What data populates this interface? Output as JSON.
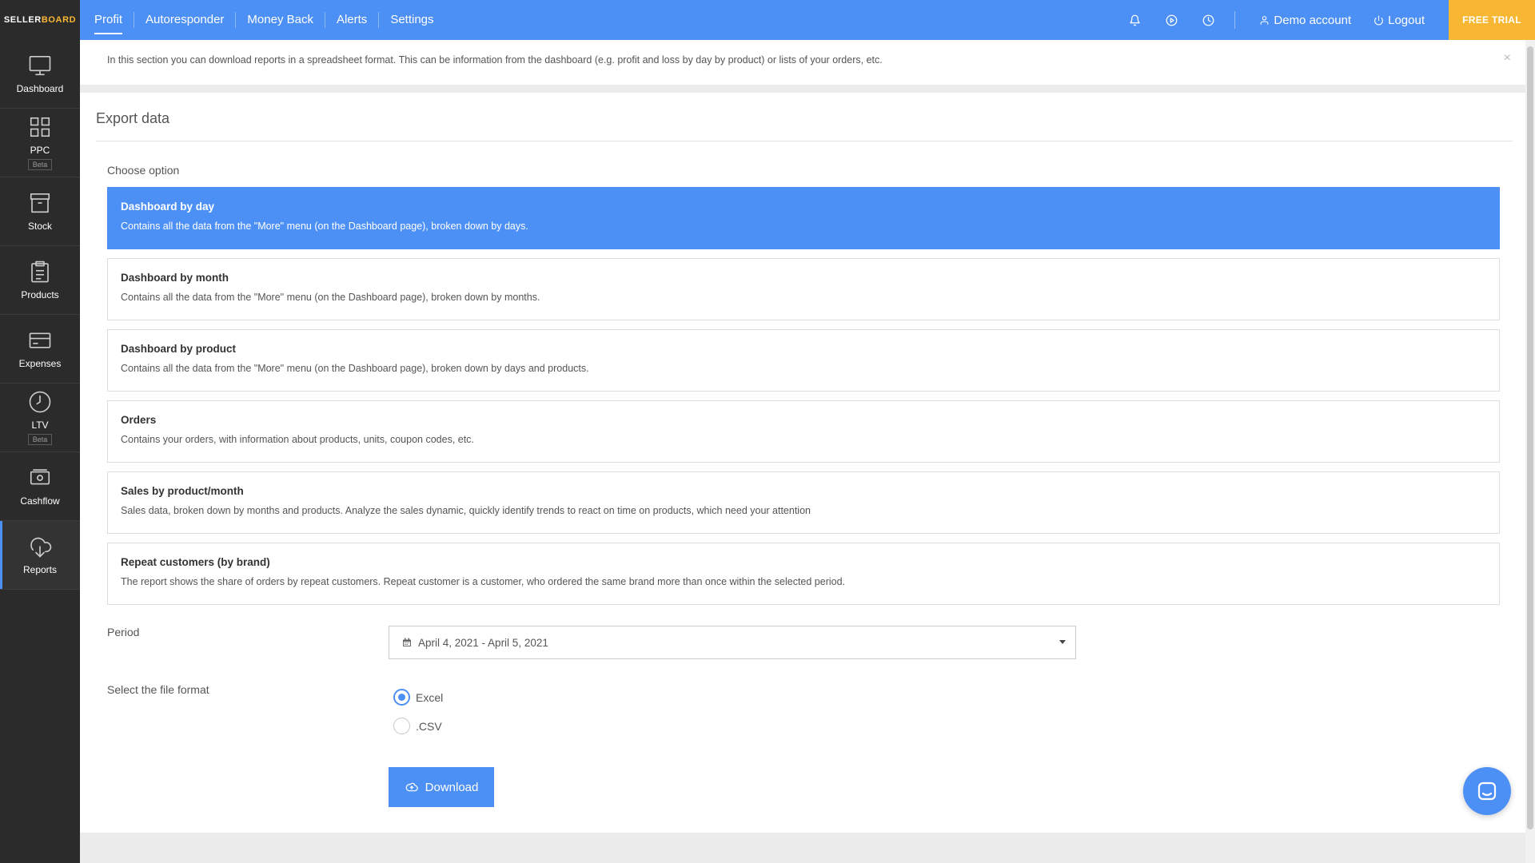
{
  "app": {
    "logo_part1": "SELLER",
    "logo_part2": "BOARD"
  },
  "topnav": {
    "items": [
      {
        "label": "Profit",
        "active": true
      },
      {
        "label": "Autoresponder"
      },
      {
        "label": "Money Back"
      },
      {
        "label": "Alerts"
      },
      {
        "label": "Settings"
      }
    ],
    "icons": [
      "bell-icon",
      "play-circle-icon",
      "clock-icon"
    ],
    "account_label": "Demo account",
    "logout_label": "Logout",
    "trial_label": "FREE TRIAL"
  },
  "sidebar": {
    "items": [
      {
        "label": "Dashboard",
        "icon": "monitor-icon"
      },
      {
        "label": "PPC",
        "icon": "grid-icon",
        "badge": "Beta"
      },
      {
        "label": "Stock",
        "icon": "box-icon"
      },
      {
        "label": "Products",
        "icon": "clipboard-icon"
      },
      {
        "label": "Expenses",
        "icon": "credit-card-icon"
      },
      {
        "label": "LTV",
        "icon": "clock-icon",
        "badge": "Beta"
      },
      {
        "label": "Cashflow",
        "icon": "cash-icon"
      },
      {
        "label": "Reports",
        "icon": "cloud-download-icon",
        "active": true
      }
    ]
  },
  "banner": {
    "text": "In this section you can download reports in a spreadsheet format. This can be information from the dashboard (e.g. profit and loss by day by product) or lists of your orders, etc.",
    "close_glyph": "×"
  },
  "export": {
    "title": "Export data",
    "choose_label": "Choose option",
    "options": [
      {
        "title": "Dashboard by day",
        "desc": "Contains all the data from the \"More\" menu (on the Dashboard page), broken down by days.",
        "selected": true
      },
      {
        "title": "Dashboard by month",
        "desc": "Contains all the data from the \"More\" menu (on the Dashboard page), broken down by months."
      },
      {
        "title": "Dashboard by product",
        "desc": "Contains all the data from the \"More\" menu (on the Dashboard page), broken down by days and products."
      },
      {
        "title": "Orders",
        "desc": "Contains your orders, with information about products, units, coupon codes, etc."
      },
      {
        "title": "Sales by product/month",
        "desc": "Sales data, broken down by months and products. Analyze the sales dynamic, quickly identify trends to react on time on products, which need your attention"
      },
      {
        "title": "Repeat customers (by brand)",
        "desc": "The report shows the share of orders by repeat customers. Repeat customer is a customer, who ordered the same brand more than once within the selected period."
      }
    ],
    "period_label": "Period",
    "period_value": "April 4, 2021 - April 5, 2021",
    "format_label": "Select the file format",
    "formats": [
      {
        "label": "Excel",
        "checked": true
      },
      {
        "label": ".CSV",
        "checked": false
      }
    ],
    "download_label": "Download"
  },
  "colors": {
    "primary": "#4d90f5",
    "accent": "#f7b733",
    "sidebar": "#2b2b2b"
  }
}
